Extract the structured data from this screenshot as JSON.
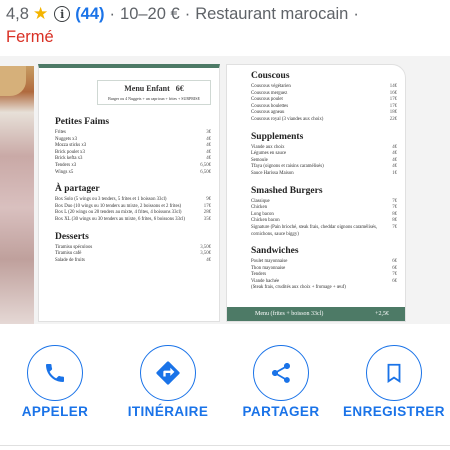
{
  "header": {
    "rating": "4,8",
    "review_count": "(44)",
    "price_range": "10–20 €",
    "category": "Restaurant marocain",
    "trailing_sep": "·",
    "status": "Fermé"
  },
  "menu_left": {
    "kids_title": "Menu Enfant",
    "kids_price": "6€",
    "kids_desc": "Burger ou 4 Nuggets + un capriсun + frites + SURPRISE",
    "sections": [
      {
        "title": "Petites Faims",
        "rows": [
          {
            "name": "Frites",
            "price": "3€"
          },
          {
            "name": "Nuggets x3",
            "price": "4€"
          },
          {
            "name": "Mozza sticks x3",
            "price": "4€"
          },
          {
            "name": "Brick poulet x3",
            "price": "4€"
          },
          {
            "name": "Brick kefta x3",
            "price": "4€"
          },
          {
            "name": "Tenders x3",
            "price": "6,50€"
          },
          {
            "name": "Wings x5",
            "price": "6,50€"
          }
        ]
      },
      {
        "title": "À partager",
        "rows": [
          {
            "name": "Box Solo (5 wings ou 3 tenders, 5 frites et 1 boisson 33cl)",
            "price": "9€"
          },
          {
            "name": "Box Duo (10 wings ou 10 tenders au mixte, 2 boissons et 2 frites)",
            "price": "17€"
          },
          {
            "name": "Box L (20 wings ou 20 tenders au mixte, 4 frites, 4 boissons 33cl)",
            "price": "28€"
          },
          {
            "name": "Box XL (30 wings ou 30 tenders au mixte, 6 frites, 6 boissons 33cl)",
            "price": "35€"
          }
        ]
      },
      {
        "title": "Desserts",
        "rows": [
          {
            "name": "Tiramisu spéculoos",
            "price": "3,50€"
          },
          {
            "name": "Tiramisu café",
            "price": "3,50€"
          },
          {
            "name": "Salade de fruits",
            "price": "4€"
          }
        ]
      }
    ]
  },
  "menu_right": {
    "sections": [
      {
        "title": "Couscous",
        "rows": [
          {
            "name": "Couscous végétarien",
            "price": "14€"
          },
          {
            "name": "Couscous merguez",
            "price": "16€"
          },
          {
            "name": "Couscous poulet",
            "price": "17€"
          },
          {
            "name": "Couscous boulettes",
            "price": "17€"
          },
          {
            "name": "Couscous agneau",
            "price": "18€"
          },
          {
            "name": "Couscous royal (3 viandes aux choix)",
            "price": "22€"
          }
        ]
      },
      {
        "title": "Supplements",
        "rows": [
          {
            "name": "Viande aux choix",
            "price": "4€"
          },
          {
            "name": "Légumes en sauce",
            "price": "4€"
          },
          {
            "name": "Semoule",
            "price": "4€"
          },
          {
            "name": "Tfaya (oignons et raisins caramélisés)",
            "price": "4€"
          },
          {
            "name": "Sauce Harissa Maison",
            "price": "1€"
          }
        ]
      },
      {
        "title": "Smashed Burgers",
        "rows": [
          {
            "name": "Classique",
            "price": "7€"
          },
          {
            "name": "Chicken",
            "price": "7€"
          },
          {
            "name": "Long bacon",
            "price": "8€"
          },
          {
            "name": "Chicken bacon",
            "price": "8€"
          },
          {
            "name": "Signature (Pain brioché, steak frais, cheddar oignons caramélisés, cornichons, sauce biggy)",
            "price": "7€"
          }
        ]
      },
      {
        "title": "Sandwiches",
        "rows": [
          {
            "name": "Poulet mayonnaise",
            "price": "6€"
          },
          {
            "name": "Thon mayonnaise",
            "price": "6€"
          },
          {
            "name": "Tenders",
            "price": "7€"
          },
          {
            "name": "Viande hachée",
            "price": "6€"
          },
          {
            "name": "(Steak frais, crudités aux choix + fromage + œuf)",
            "price": ""
          }
        ]
      }
    ],
    "footer_label": "Menu (frites + boisson 33cl)",
    "footer_price": "+2,5€"
  },
  "actions": [
    {
      "label": "APPELER",
      "icon": "phone-icon"
    },
    {
      "label": "ITINÉRAIRE",
      "icon": "directions-icon"
    },
    {
      "label": "PARTAGER",
      "icon": "share-icon"
    },
    {
      "label": "ENREGISTRER",
      "icon": "bookmark-icon"
    }
  ],
  "colors": {
    "accent": "#1a73e8",
    "closed": "#d93025",
    "star": "#f4b400",
    "menu_green": "#4d7a66"
  }
}
